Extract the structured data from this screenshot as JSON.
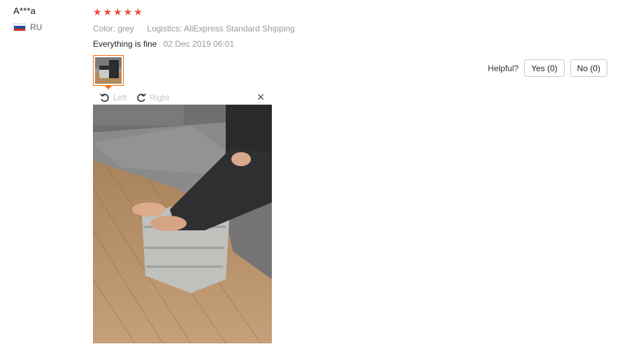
{
  "reviewer": {
    "name": "A***a",
    "country_code": "RU"
  },
  "review": {
    "rating": 5,
    "stars": [
      "★",
      "★",
      "★",
      "★",
      "★"
    ],
    "star_color": "#e84c3d",
    "color_label": "Color:",
    "color_value": "grey",
    "logistics_label": "Logistics:",
    "logistics_value": "AliExpress Standard Shipping",
    "text": "Everything is fine",
    "date": "02 Dec 2019 06:01"
  },
  "viewer": {
    "rotate_left_label": "Left",
    "rotate_right_label": "Right",
    "close_glyph": "✕",
    "thumb_border_color": "#ff6a00"
  },
  "helpful": {
    "label": "Helpful?",
    "yes_label": "Yes (0)",
    "no_label": "No (0)"
  }
}
